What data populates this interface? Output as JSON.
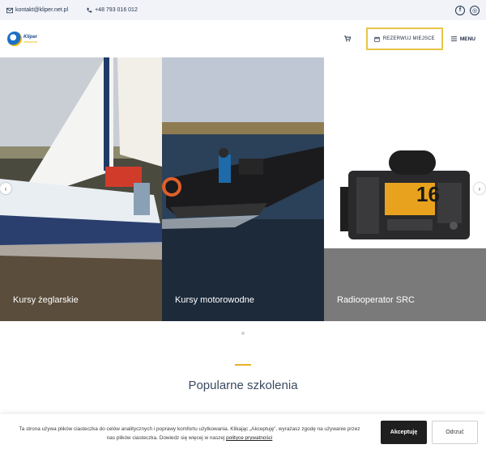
{
  "topbar": {
    "email": "kontakt@kliper.net.pl",
    "phone": "+48 793 016 012",
    "social": [
      {
        "icon": "facebook-icon",
        "glyph": "f"
      },
      {
        "icon": "instagram-icon",
        "glyph": "◎"
      }
    ]
  },
  "header": {
    "logo_text": "Kliper",
    "logo_subtext": "szkolenia",
    "reserve_label": "REZERWUJ MIEJSCE",
    "menu_label": "MENU"
  },
  "slider": {
    "slides": [
      {
        "caption": "Kursy żeglarskie"
      },
      {
        "caption": "Kursy motorowodne"
      },
      {
        "caption": "Radiooperator SRC"
      }
    ],
    "radio_display": "16",
    "prev_glyph": "‹",
    "next_glyph": "›"
  },
  "section": {
    "title": "Popularne szkolenia"
  },
  "cookie": {
    "text_before": "Ta strona używa plików ciasteczka do celów analitycznych i poprawy komfortu użytkowania. Klikając „Akceptuję”, wyrażasz zgodę na używanie przez nas plików ciasteczka. Dowiedz się więcej w naszej ",
    "link": "polityce prywatności",
    "accept_label": "Akceptuję",
    "refuse_label": "Odrzuć"
  },
  "colors": {
    "accent": "#e8c547",
    "dark": "#1f1f1f",
    "topbar_bg": "#f1f3f8"
  }
}
